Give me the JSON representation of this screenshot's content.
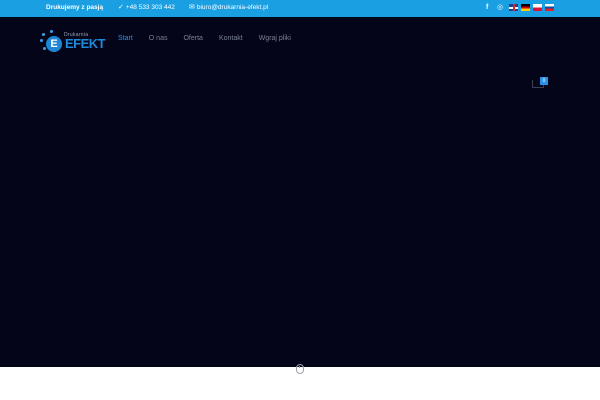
{
  "topbar": {
    "tagline": "Drukujemy z pasją",
    "phone": "+48 533 303 442",
    "email": "biuro@drukarnia-efekt.pl",
    "social": [
      "f",
      "◎"
    ],
    "languages": [
      "English",
      "Deutsch",
      "Polski",
      "Slovenčina"
    ],
    "accent": "#1a9fe3"
  },
  "header": {
    "logo": {
      "small_text": "Drukarnia",
      "big_text": "EFEKT",
      "letter": "E"
    },
    "nav": [
      "Start",
      "O nas",
      "Oferta",
      "Kontakt",
      "Wgraj pliki"
    ],
    "active_nav": "Start",
    "cart_count": "0",
    "background": "#050519"
  }
}
